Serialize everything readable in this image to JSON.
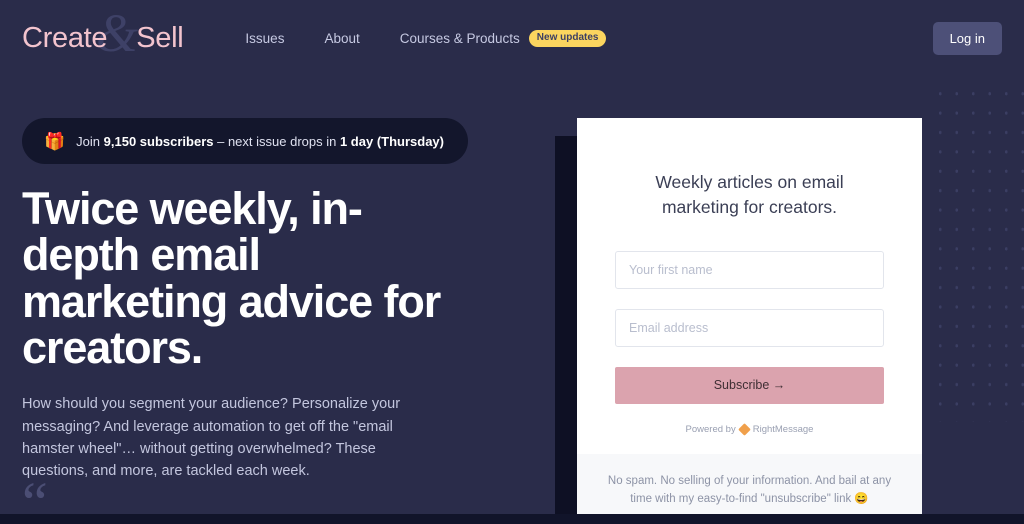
{
  "brand": {
    "word_one": "Create",
    "ampersand": "&",
    "word_two": "Sell",
    "pink": "#f3c4ce"
  },
  "header": {
    "nav": [
      {
        "label": "Issues",
        "badge": null
      },
      {
        "label": "About",
        "badge": null
      },
      {
        "label": "Courses & Products",
        "badge": "New updates"
      }
    ],
    "login_label": "Log in",
    "badge_color": "#fbd55f"
  },
  "hero": {
    "notice": {
      "icon": "gift-icon",
      "emoji": "🎁",
      "prefix": "Join ",
      "subscriber_count": "9,150 subscribers",
      "middle": " – next issue drops in ",
      "countdown": "1 day (Thursday)"
    },
    "headline": "Twice weekly, in-depth email marketing advice for creators.",
    "subcopy": "How should you segment your audience? Personalize your messaging? And leverage automation to get off the \"email hamster wheel\"… without getting overwhelmed? These questions, and more, are tackled each week.",
    "quote_glyph": "“"
  },
  "signup": {
    "title": "Weekly articles on email marketing for creators.",
    "first_name_placeholder": "Your first name",
    "first_name_value": "",
    "email_placeholder": "Email address",
    "email_value": "",
    "subscribe_label": "Subscribe →",
    "subscribe_color": "#dba3ae",
    "powered_prefix": "Powered by",
    "powered_brand": "RightMessage",
    "footer_note": "No spam. No selling of your information. And bail at any time with my easy-to-find \"unsubscribe\" link 😄"
  },
  "theme": {
    "background": "#2a2c4a",
    "pill_background": "#13162c",
    "card_background": "#ffffff"
  }
}
